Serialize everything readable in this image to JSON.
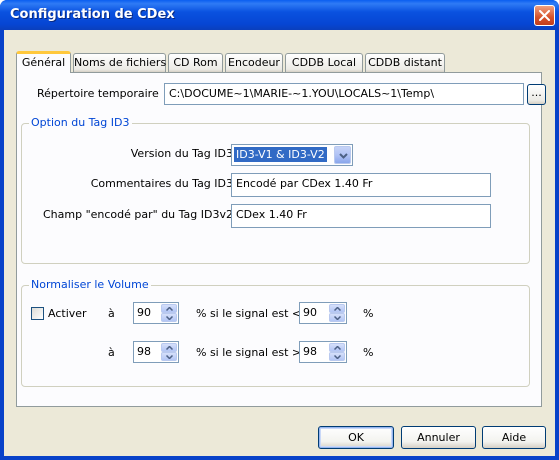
{
  "window": {
    "title": "Configuration de CDex"
  },
  "tabs": [
    {
      "label": "Général",
      "active": true
    },
    {
      "label": "Noms de fichiers"
    },
    {
      "label": "CD Rom"
    },
    {
      "label": "Encodeur"
    },
    {
      "label": "CDDB Local"
    },
    {
      "label": "CDDB distant"
    }
  ],
  "general": {
    "temp_dir_label": "Répertoire temporaire",
    "temp_dir_value": "C:\\DOCUME~1\\MARIE-~1.YOU\\LOCALS~1\\Temp\\",
    "browse_label": "..."
  },
  "id3_group": {
    "title": "Option du Tag ID3",
    "version_label": "Version du Tag ID3",
    "version_value": "ID3-V1 & ID3-V2",
    "comments_label": "Commentaires du Tag ID3",
    "comments_value": "Encodé par CDex 1.40 Fr",
    "encoded_by_label": "Champ \"encodé par\" du Tag ID3v2",
    "encoded_by_value": "CDex 1.40 Fr"
  },
  "volume_group": {
    "title": "Normaliser le Volume",
    "activate_label": "Activer",
    "activate_checked": false,
    "row1": {
      "a_label": "à",
      "value1": "90",
      "cond_label": "% si le signal est <",
      "value2": "90",
      "unit": "%"
    },
    "row2": {
      "a_label": "à",
      "value1": "98",
      "cond_label": "% si le signal est >",
      "value2": "98",
      "unit": "%"
    }
  },
  "buttons": {
    "ok": "OK",
    "cancel": "Annuler",
    "help": "Aide"
  },
  "icons": {
    "close": "close-icon",
    "dropdown": "chevron-down-icon",
    "spin_up": "arrow-up-icon",
    "spin_down": "arrow-down-icon"
  }
}
